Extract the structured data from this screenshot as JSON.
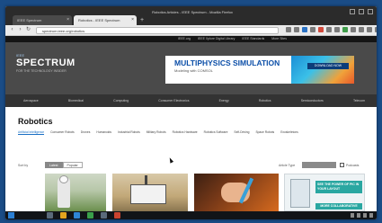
{
  "browser": {
    "window_title": "Robotics Articles - IEEE Spectrum - Mozilla Firefox",
    "tabs": [
      {
        "label": "IEEE Spectrum",
        "active": false
      },
      {
        "label": "Robotics - IEEE Spectrum",
        "active": true
      }
    ],
    "url": "spectrum.ieee.org/robotics"
  },
  "site": {
    "brand": "SPECTRUM",
    "brand_prefix": "IEEE",
    "brand_tagline": "FOR THE TECHNOLOGY INSIDER",
    "util_links": [
      "IEEE.org",
      "IEEE Xplore Digital Library",
      "IEEE Standards",
      "More Sites"
    ],
    "nav": [
      "Aerospace",
      "Biomedical",
      "Computing",
      "Consumer Electronics",
      "Energy",
      "Robotics",
      "Semiconductors",
      "Telecom"
    ]
  },
  "ad": {
    "headline": "MULTIPHYSICS SIMULATION",
    "sub": "Modeling with COMSOL",
    "cta": "DOWNLOAD NOW"
  },
  "page": {
    "title": "Robotics",
    "subtopics": [
      "Artificial Intelligence",
      "Consumer Robots",
      "Drones",
      "Humanoids",
      "Industrial Robots",
      "Military Robots",
      "Robotics Hardware",
      "Robotics Software",
      "Self-Driving",
      "Space Robots",
      "Exoskeletons"
    ],
    "selected_subtopic": "Artificial Intelligence",
    "sort": {
      "label": "Sort by",
      "options": [
        "Latest",
        "Popular"
      ],
      "selected": "Latest"
    },
    "filter": {
      "label": "Article Type",
      "checkbox_label": "Podcasts"
    }
  },
  "sidebar_ad": {
    "text": "SEE THE POWER OF PIC IN YOUR LAYOUT",
    "cta": "MORE COLLABORATIVE"
  },
  "colors": {
    "header_bg": "#4a4a4a",
    "navbar_bg": "#333333",
    "link_blue": "#1a6fc4",
    "ad_blue": "#0c4fa8",
    "teal": "#2aa7a1"
  }
}
